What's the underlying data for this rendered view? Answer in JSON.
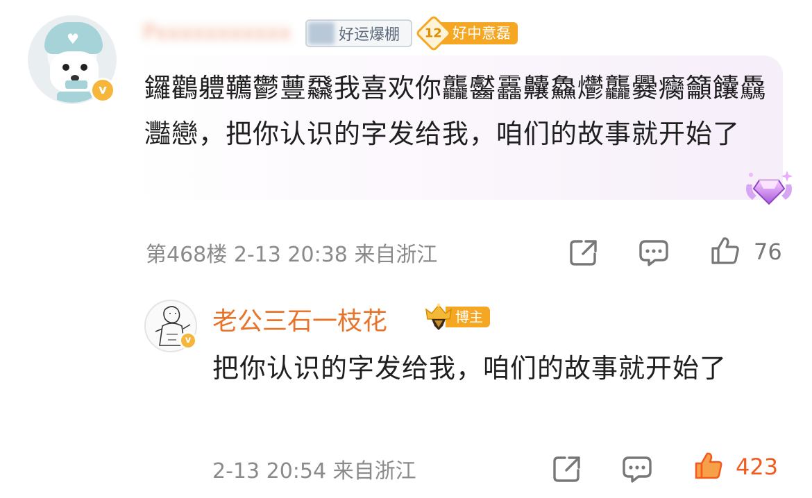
{
  "comment": {
    "username": "Pxxxxxxxxxxx",
    "badges": {
      "lucky_tag": "好运爆棚",
      "level_number": "12",
      "level_label": "好中意磊"
    },
    "verified_badge": "v",
    "text": "鑼鸛軆韉鬱蘴飝我喜欢你龘齾靐齉鱻爩龘爨癵籲饢驫灩戀，把你认识的字发给我，咱们的故事就开始了",
    "floor": "第468楼",
    "timestamp": "2-13 20:38",
    "location": "来自浙江",
    "like_count": "76",
    "actions": {
      "share_icon": "share-icon",
      "comment_icon": "comment-icon",
      "like_icon": "thumbs-up-icon"
    }
  },
  "reply": {
    "username": "老公三石一枝花",
    "badge_label": "博主",
    "verified_badge": "v",
    "text": "把你认识的字发给我，咱们的故事就开始了",
    "timestamp": "2-13 20:54",
    "location": "来自浙江",
    "like_count": "423",
    "liked": true
  },
  "colors": {
    "reply_name": "#e8742c",
    "badge_orange": "#f5a623",
    "liked_orange": "#f25b20",
    "meta_gray": "#8a8a8a"
  }
}
